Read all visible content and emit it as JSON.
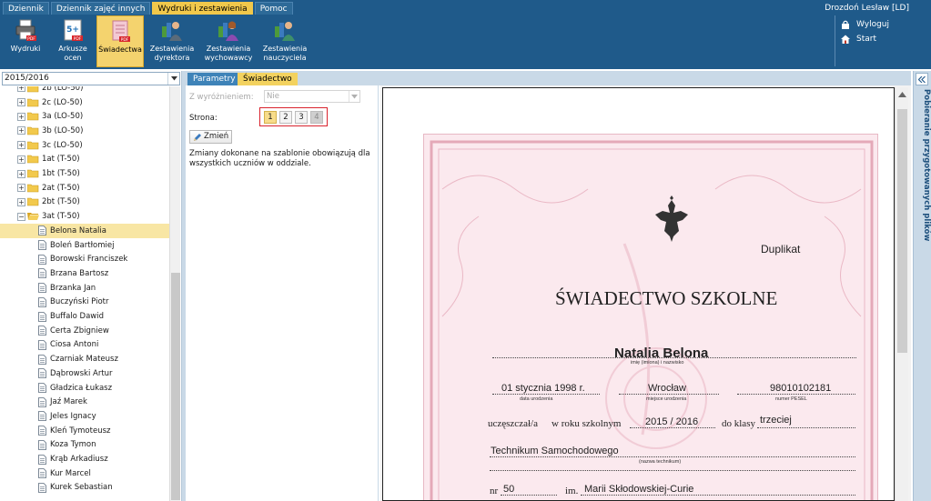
{
  "menu": {
    "tabs": [
      {
        "label": "Dziennik"
      },
      {
        "label": "Dziennik zajęć innych"
      },
      {
        "label": "Wydruki i zestawienia"
      },
      {
        "label": "Pomoc"
      }
    ],
    "active_tab": 2
  },
  "user": {
    "name": "Drozdoń Lesław [LD]"
  },
  "toolbar": {
    "items": [
      {
        "label": "Wydruki",
        "icon": "printer-icon"
      },
      {
        "label": "Arkusze ocen",
        "icon": "grade-sheet-icon"
      },
      {
        "label": "Świadectwa",
        "icon": "certificate-icon"
      },
      {
        "label": "Zestawienia dyrektora",
        "icon": "director-icon"
      },
      {
        "label": "Zestawienia wychowawcy",
        "icon": "tutor-icon"
      },
      {
        "label": "Zestawienia nauczyciela",
        "icon": "teacher-icon"
      }
    ],
    "active_index": 2,
    "pdf_badge": "PDF",
    "grade_badge": "5+"
  },
  "right_links": {
    "logout": "Wyloguj",
    "start": "Start"
  },
  "left": {
    "year": "2015/2016",
    "tree": [
      {
        "label": "2b (LO-50)",
        "type": "folder"
      },
      {
        "label": "2c (LO-50)",
        "type": "folder"
      },
      {
        "label": "3a (LO-50)",
        "type": "folder"
      },
      {
        "label": "3b (LO-50)",
        "type": "folder"
      },
      {
        "label": "3c (LO-50)",
        "type": "folder"
      },
      {
        "label": "1at (T-50)",
        "type": "folder"
      },
      {
        "label": "1bt (T-50)",
        "type": "folder"
      },
      {
        "label": "2at (T-50)",
        "type": "folder"
      },
      {
        "label": "2bt (T-50)",
        "type": "folder"
      },
      {
        "label": "3at (T-50)",
        "type": "folder-open"
      },
      {
        "label": "Belona Natalia",
        "type": "student",
        "selected": true
      },
      {
        "label": "Boleń Bartłomiej",
        "type": "student"
      },
      {
        "label": "Borowski Franciszek",
        "type": "student"
      },
      {
        "label": "Brzana Bartosz",
        "type": "student"
      },
      {
        "label": "Brzanka Jan",
        "type": "student"
      },
      {
        "label": "Buczyński Piotr",
        "type": "student"
      },
      {
        "label": "Buffalo Dawid",
        "type": "student"
      },
      {
        "label": "Certa Zbigniew",
        "type": "student"
      },
      {
        "label": "Ciosa Antoni",
        "type": "student"
      },
      {
        "label": "Czarniak Mateusz",
        "type": "student"
      },
      {
        "label": "Dąbrowski Artur",
        "type": "student"
      },
      {
        "label": "Gładzica Łukasz",
        "type": "student"
      },
      {
        "label": "Jaź Marek",
        "type": "student"
      },
      {
        "label": "Jeles Ignacy",
        "type": "student"
      },
      {
        "label": "Kleń Tymoteusz",
        "type": "student"
      },
      {
        "label": "Koza Tymon",
        "type": "student"
      },
      {
        "label": "Krąb Arkadiusz",
        "type": "student"
      },
      {
        "label": "Kur Marcel",
        "type": "student"
      },
      {
        "label": "Kurek Sebastian",
        "type": "student"
      }
    ]
  },
  "tabs": {
    "params": "Parametry",
    "cert": "Świadectwo"
  },
  "params": {
    "distinction_label": "Z wyróżnieniem:",
    "distinction_value": "Nie",
    "page_label": "Strona:",
    "pages": [
      "1",
      "2",
      "3",
      "4"
    ],
    "active_page": 0,
    "disabled_page": 3,
    "change_button": "Zmień",
    "note": "Zmiany dokonane na szablonie obowiązują dla wszystkich uczniów w oddziale."
  },
  "certificate": {
    "duplicate": "Duplikat",
    "title": "ŚWIADECTWO SZKOLNE",
    "student_name": "Natalia Belona",
    "name_caption": "imię (imiona) i nazwisko",
    "birth_date": "01 stycznia 1998 r.",
    "birth_date_caption": "data urodzenia",
    "birth_place": "Wrocław",
    "birth_place_caption": "miejsce urodzenia",
    "pesel": "98010102181",
    "pesel_caption": "numer PESEL",
    "attended_label": "uczęszczał/a",
    "year_label": "w roku szkolnym",
    "school_year": "2015 / 2016",
    "class_label": "do klasy",
    "class_value": "trzeciej",
    "school_type": "Technikum Samochodowego",
    "school_type_caption": "(nazwa technikum)",
    "nr_label": "nr",
    "nr_value": "50",
    "im_label": "im.",
    "patron": "Marii Skłodowskiej-Curie"
  },
  "right_sidebar": {
    "title": "Pobieranie przygotowanych plików"
  },
  "colors": {
    "header_bg": "#1f5a8a",
    "active_yellow": "#f1c84b",
    "panel_border": "#c9d9e7",
    "page_highlight": "#d9232d",
    "certificate_bg": "#fbe9ee"
  }
}
